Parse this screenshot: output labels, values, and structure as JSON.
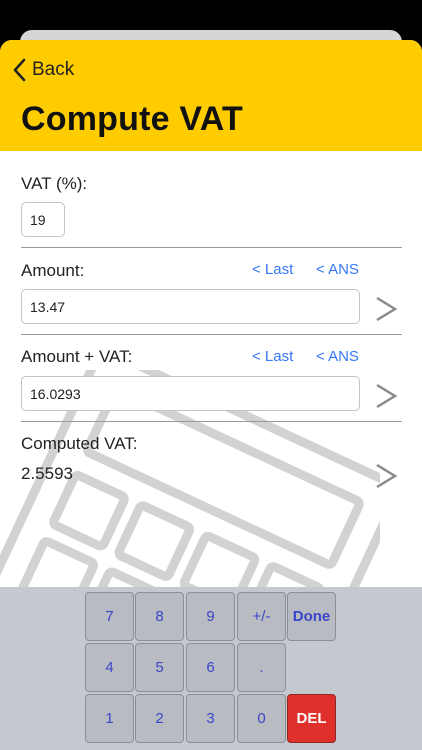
{
  "header": {
    "back_label": "Back",
    "title": "Compute VAT"
  },
  "vat": {
    "label": "VAT (%):",
    "value": "19"
  },
  "amount": {
    "label": "Amount:",
    "last_link": "< Last",
    "ans_link": "< ANS",
    "value": "13.47"
  },
  "amount_vat": {
    "label": "Amount + VAT:",
    "last_link": "< Last",
    "ans_link": "< ANS",
    "value": "16.0293"
  },
  "computed": {
    "label": "Computed VAT:",
    "value": "2.5593"
  },
  "keypad": {
    "k7": "7",
    "k8": "8",
    "k9": "9",
    "kpm": "+/-",
    "kdone": "Done",
    "k4": "4",
    "k5": "5",
    "k6": "6",
    "kdot": ".",
    "k1": "1",
    "k2": "2",
    "k3": "3",
    "k0": "0",
    "kdel": "DEL"
  },
  "colors": {
    "header": "#ffcc00",
    "link": "#3478f6",
    "key_text": "#3a46c8",
    "delete": "#e0302c"
  },
  "icons": {
    "back": "chevron-left-icon",
    "next": "chevron-right-icon",
    "watermark": "calculator-icon"
  }
}
